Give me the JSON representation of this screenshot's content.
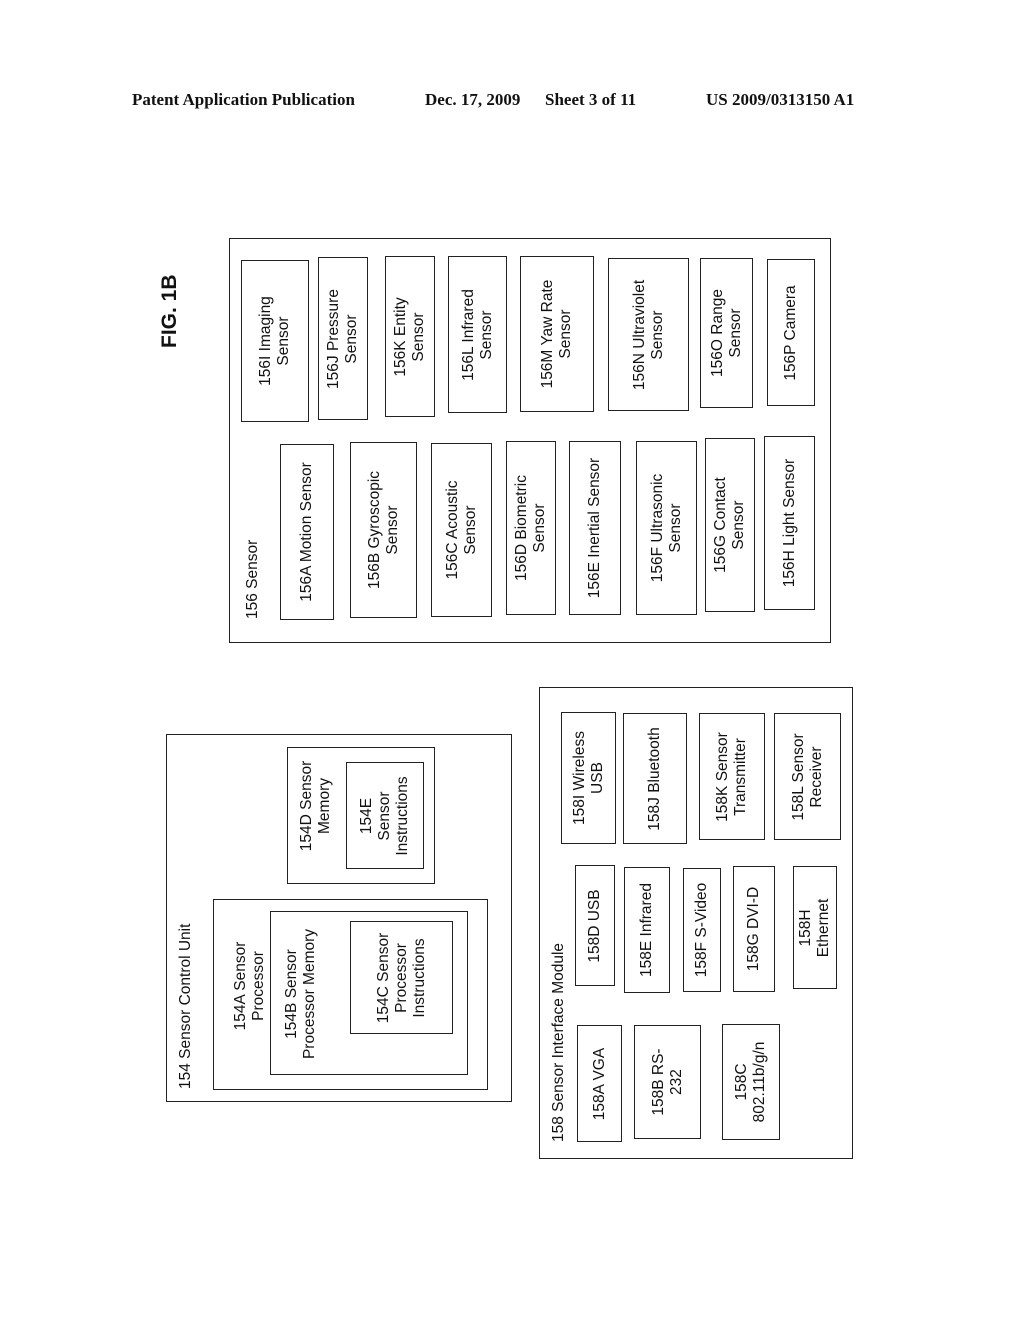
{
  "header": {
    "left": "Patent Application Publication",
    "date": "Dec. 17, 2009",
    "sheet": "Sheet 3 of 11",
    "number": "US 2009/0313150 A1"
  },
  "figure_label": "FIG. 1B",
  "sensor": {
    "title": "156 Sensor",
    "items": [
      {
        "id": "156I",
        "label": "156I Imaging\nSensor"
      },
      {
        "id": "156J",
        "label": "156J Pressure\nSensor"
      },
      {
        "id": "156K",
        "label": "156K Entity\nSensor"
      },
      {
        "id": "156L",
        "label": "156L Infrared\nSensor"
      },
      {
        "id": "156M",
        "label": "156M Yaw Rate\nSensor"
      },
      {
        "id": "156N",
        "label": "156N Ultraviolet\nSensor"
      },
      {
        "id": "156O",
        "label": "156O Range\nSensor"
      },
      {
        "id": "156P",
        "label": "156P Camera"
      },
      {
        "id": "156A",
        "label": "156A Motion Sensor"
      },
      {
        "id": "156B",
        "label": "156B Gyroscopic\nSensor"
      },
      {
        "id": "156C",
        "label": "156C Acoustic\nSensor"
      },
      {
        "id": "156D",
        "label": "156D Biometric\nSensor"
      },
      {
        "id": "156E",
        "label": "156E Inertial Sensor"
      },
      {
        "id": "156F",
        "label": "156F Ultrasonic\nSensor"
      },
      {
        "id": "156G",
        "label": "156G Contact\nSensor"
      },
      {
        "id": "156H",
        "label": "156H Light Sensor"
      }
    ]
  },
  "control_unit": {
    "title": "154 Sensor Control Unit",
    "processor": "154A Sensor\nProcessor",
    "processor_memory": "154B Sensor\nProcessor Memory",
    "processor_instructions": "154C Sensor\nProcessor\nInstructions",
    "memory": "154D Sensor\nMemory",
    "instructions": "154E\nSensor\nInstructions"
  },
  "interface_module": {
    "title": "158 Sensor Interface Module",
    "items": [
      {
        "id": "158A",
        "label": "158A VGA"
      },
      {
        "id": "158B",
        "label": "158B RS-\n232"
      },
      {
        "id": "158C",
        "label": "158C\n802.11b/g/n"
      },
      {
        "id": "158D",
        "label": "158D USB"
      },
      {
        "id": "158E",
        "label": "158E Infrared"
      },
      {
        "id": "158F",
        "label": "158F S-Video"
      },
      {
        "id": "158G",
        "label": "158G DVI-D"
      },
      {
        "id": "158H",
        "label": "158H\nEthernet"
      },
      {
        "id": "158I",
        "label": "158I Wireless\nUSB"
      },
      {
        "id": "158J",
        "label": "158J Bluetooth"
      },
      {
        "id": "158K",
        "label": "158K Sensor\nTransmitter"
      },
      {
        "id": "158L",
        "label": "158L Sensor\nReceiver"
      }
    ]
  }
}
